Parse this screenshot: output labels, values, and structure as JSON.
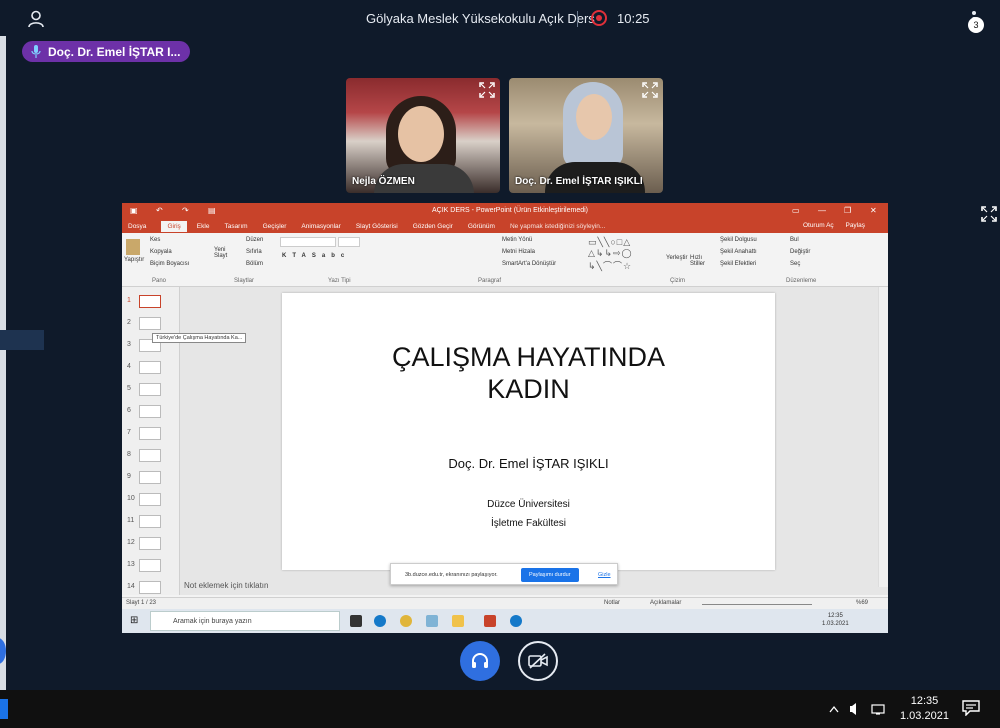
{
  "topbar": {
    "meeting_title": "Gölyaka Meslek Yüksekokulu Açık Ders",
    "timer": "10:25"
  },
  "speaker": {
    "name": "Doç. Dr. Emel İŞTAR I..."
  },
  "tiles": [
    {
      "name": "Nejla ÖZMEN"
    },
    {
      "name": "Doç. Dr. Emel İŞTAR IŞIKLI"
    }
  ],
  "ppt": {
    "window_title": "AÇIK DERS - PowerPoint (Ürün Etkinleştirilemedi)",
    "tabs": [
      "Dosya",
      "Giriş",
      "Ekle",
      "Tasarım",
      "Geçişler",
      "Animasyonlar",
      "Slayt Gösterisi",
      "Gözden Geçir",
      "Görünüm"
    ],
    "tell_me": "Ne yapmak istediğinizi söyleyin...",
    "sign_in": "Oturum Aç",
    "share": "Paylaş",
    "ribbon": {
      "cut": "Kes",
      "copy": "Kopyala",
      "format_painter": "Biçim Boyacısı",
      "paste": "Yapıştır",
      "new_slide": "Yeni Slayt",
      "layout": "Düzen",
      "reset": "Sıfırla",
      "section": "Bölüm",
      "text_direction": "Metin Yönü",
      "align_text": "Metni Hizala",
      "smartart": "SmartArt'a Dönüştür",
      "arrange": "Yerleştir",
      "quick_styles": "Hızlı Stiller",
      "shape_fill": "Şekil Dolgusu",
      "shape_outline": "Şekil Anahattı",
      "shape_effects": "Şekil Efektleri",
      "find": "Bul",
      "replace": "Değiştir",
      "select": "Seç",
      "groups": [
        "Pano",
        "Slaytlar",
        "Yazı Tipi",
        "Paragraf",
        "Çizim",
        "Düzenleme"
      ]
    },
    "thumb_numbers": [
      "1",
      "2",
      "3",
      "4",
      "5",
      "6",
      "7",
      "8",
      "9",
      "10",
      "11",
      "12",
      "13",
      "14"
    ],
    "tooltip": "Türkiye'de Çalışma Hayatında Ka...",
    "slide": {
      "title_line1": "ÇALIŞMA HAYATINDA",
      "title_line2": "KADIN",
      "author": "Doç. Dr. Emel İŞTAR IŞIKLI",
      "university": "Düzce Üniversitesi",
      "faculty": "İşletme Fakültesi"
    },
    "notes_placeholder": "Not eklemek için tıklatın",
    "share_bar": {
      "message": "3b.duzce.edu.tr, ekranınızı paylaşıyor.",
      "stop_label": "Paylaşımı durdur",
      "hide_label": "Gizle"
    },
    "status": {
      "slide_counter": "Slayt 1 / 23",
      "notes": "Notlar",
      "comments": "Açıklamalar",
      "zoom": "%69"
    },
    "taskbar": {
      "search_placeholder": "Aramak için buraya yazın",
      "time": "12:35",
      "date": "1.03.2021"
    }
  },
  "host_taskbar": {
    "time": "12:35",
    "date": "1.03.2021",
    "notification_count": "3"
  }
}
